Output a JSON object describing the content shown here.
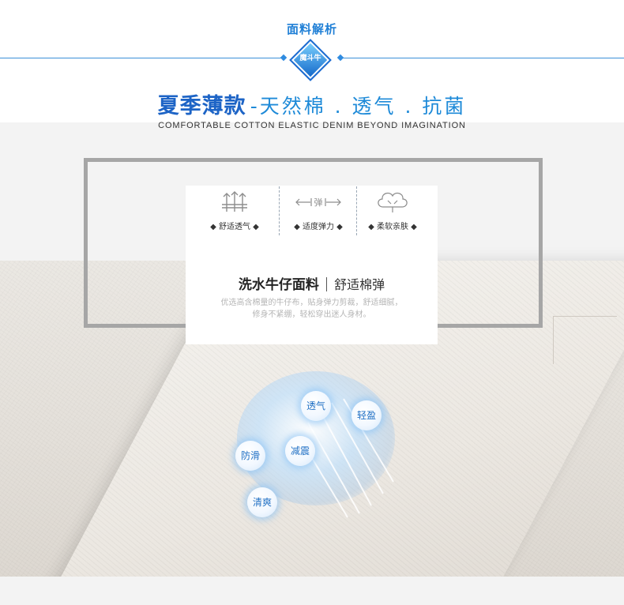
{
  "header": {
    "section_title": "面料解析",
    "badge_text": "魔斗牛",
    "headline_main": "夏季薄款",
    "headline_sub": "-天然棉 . 透气 . 抗菌",
    "english_tagline": "COMFORTABLE COTTON ELASTIC DENIM BEYOND IMAGINATION"
  },
  "features": [
    {
      "icon": "breathable-icon",
      "label": "◆ 舒适透气 ◆"
    },
    {
      "icon": "stretch-icon",
      "label": "◆ 适度弹力 ◆",
      "icon_text": "弹"
    },
    {
      "icon": "cotton-icon",
      "label": "◆ 柔软亲肤 ◆"
    }
  ],
  "card": {
    "title_main": "洗水牛仔面料",
    "title_sub": "舒适棉弹",
    "desc_line1": "优选高含棉量的牛仔布，贴身弹力剪裁，舒适细腻，",
    "desc_line2": "修身不紧绷，轻松穿出迷人身材。"
  },
  "bubbles": [
    {
      "label": "透气"
    },
    {
      "label": "轻盈"
    },
    {
      "label": "防滑"
    },
    {
      "label": "减震"
    },
    {
      "label": "清爽"
    }
  ],
  "colors": {
    "accent_blue": "#1d64c6",
    "light_blue": "#1e8ad8",
    "frame_grey": "#a6a6a6"
  }
}
